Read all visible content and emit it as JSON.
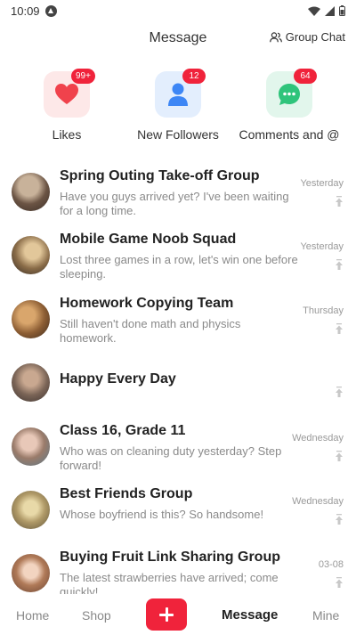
{
  "status": {
    "time": "10:09",
    "icons": [
      "app-notification-icon",
      "wifi-icon",
      "cellular-icon",
      "battery-icon"
    ]
  },
  "header": {
    "title": "Message",
    "group_chat_label": "Group Chat",
    "group_chat_icon": "users-icon"
  },
  "quick": [
    {
      "label": "Likes",
      "badge": "99+",
      "icon": "heart-icon",
      "tile_color": "#fde8e8",
      "icon_color": "#f0424c"
    },
    {
      "label": "New Followers",
      "badge": "12",
      "icon": "person-icon",
      "tile_color": "#e3eefd",
      "icon_color": "#3d86f5"
    },
    {
      "label": "Comments and @",
      "badge": "64",
      "icon": "chat-bubble-icon",
      "tile_color": "#e2f6ec",
      "icon_color": "#2fc47b"
    }
  ],
  "chats": [
    {
      "title": "Spring Outing Take-off Group",
      "preview": "Have you guys arrived yet? I've been waiting for a long time.",
      "time": "Yesterday"
    },
    {
      "title": "Mobile Game Noob Squad",
      "preview": "Lost three games in a row, let's win one before sleeping.",
      "time": "Yesterday"
    },
    {
      "title": "Homework Copying Team",
      "preview": "Still haven't done math and physics homework.",
      "time": "Thursday"
    },
    {
      "title": "Happy Every Day",
      "preview": "",
      "time": ""
    },
    {
      "title": "Class 16, Grade 11",
      "preview": "Who was on cleaning duty yesterday? Step forward!",
      "time": "Wednesday"
    },
    {
      "title": "Best Friends Group",
      "preview": "Whose boyfriend is this? So handsome!",
      "time": "Wednesday"
    },
    {
      "title": "Buying Fruit Link Sharing Group",
      "preview": "The latest strawberries have arrived; come quickly!",
      "time": "03-08"
    }
  ],
  "nav": {
    "home": "Home",
    "shop": "Shop",
    "message": "Message",
    "mine": "Mine",
    "add_icon": "plus-icon",
    "accent": "#f0233b"
  }
}
